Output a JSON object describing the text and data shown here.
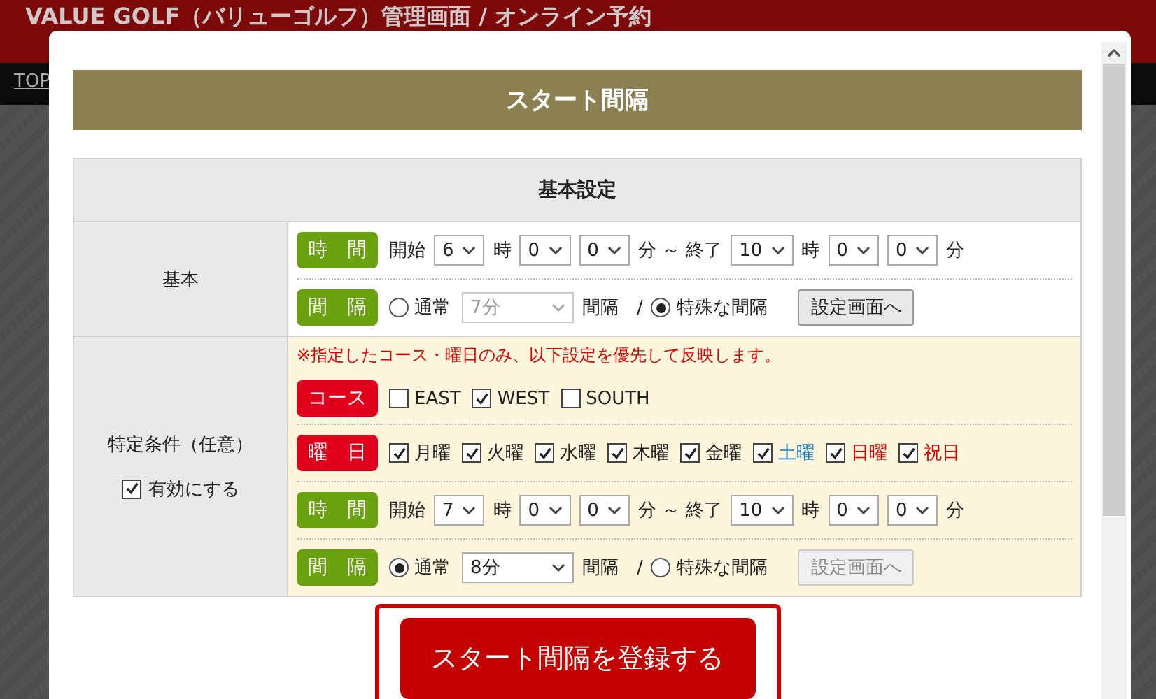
{
  "header": {
    "title": "VALUE GOLF（バリューゴルフ）管理画面 / オンライン予約"
  },
  "nav": {
    "link": "TOP"
  },
  "modal": {
    "title": "スタート間隔",
    "table_heading": "基本設定",
    "sections": [
      {
        "label": "基本",
        "rows": [
          {
            "kind": "controls",
            "tag": {
              "text": "時　間",
              "color": "#6aa10e"
            },
            "parts": [
              {
                "kind": "text",
                "text": "開始"
              },
              {
                "kind": "select",
                "value": "6",
                "disabled": false
              },
              {
                "kind": "text",
                "text": "時"
              },
              {
                "kind": "select",
                "value": "0",
                "disabled": false
              },
              {
                "kind": "select",
                "value": "0",
                "disabled": false
              },
              {
                "kind": "text",
                "text": "分 ～ 終了"
              },
              {
                "kind": "select",
                "value": "10",
                "disabled": false
              },
              {
                "kind": "text",
                "text": "時"
              },
              {
                "kind": "select",
                "value": "0",
                "disabled": false
              },
              {
                "kind": "select",
                "value": "0",
                "disabled": false
              },
              {
                "kind": "text",
                "text": "分"
              }
            ]
          },
          {
            "kind": "controls",
            "tag": {
              "text": "間　隔",
              "color": "#6aa10e"
            },
            "parts": [
              {
                "kind": "radio",
                "text": "通常",
                "selected": false
              },
              {
                "kind": "wide-select",
                "value": "7分",
                "disabled": true
              },
              {
                "kind": "text",
                "text": "間隔　/"
              },
              {
                "kind": "radio",
                "text": "特殊な間隔",
                "selected": true
              },
              {
                "kind": "button",
                "text": "設定画面へ",
                "disabled": false
              }
            ]
          }
        ]
      },
      {
        "label": "特定条件（任意）",
        "checkbox": {
          "text": "有効にする",
          "checked": true
        },
        "rows": [
          {
            "kind": "note",
            "text": "※指定したコース・曜日のみ、以下設定を優先して反映します。"
          },
          {
            "kind": "controls",
            "tag": {
              "text": "コース",
              "color": "#e0001b"
            },
            "parts": [
              {
                "kind": "checkbox",
                "text": "EAST",
                "checked": false
              },
              {
                "kind": "checkbox",
                "text": "WEST",
                "checked": true
              },
              {
                "kind": "checkbox",
                "text": "SOUTH",
                "checked": false
              }
            ]
          },
          {
            "kind": "controls",
            "tag": {
              "text": "曜　日",
              "color": "#e0001b"
            },
            "parts": [
              {
                "kind": "checkbox",
                "text": "月曜",
                "checked": true,
                "color": "#222222"
              },
              {
                "kind": "checkbox",
                "text": "火曜",
                "checked": true,
                "color": "#222222"
              },
              {
                "kind": "checkbox",
                "text": "水曜",
                "checked": true,
                "color": "#222222"
              },
              {
                "kind": "checkbox",
                "text": "木曜",
                "checked": true,
                "color": "#222222"
              },
              {
                "kind": "checkbox",
                "text": "金曜",
                "checked": true,
                "color": "#222222"
              },
              {
                "kind": "checkbox",
                "text": "土曜",
                "checked": true,
                "color": "#1a7fd0"
              },
              {
                "kind": "checkbox",
                "text": "日曜",
                "checked": true,
                "color": "#e00000"
              },
              {
                "kind": "checkbox",
                "text": "祝日",
                "checked": true,
                "color": "#e00000"
              }
            ]
          },
          {
            "kind": "controls",
            "tag": {
              "text": "時　間",
              "color": "#6aa10e"
            },
            "parts": [
              {
                "kind": "text",
                "text": "開始"
              },
              {
                "kind": "select",
                "value": "7",
                "disabled": false
              },
              {
                "kind": "text",
                "text": "時"
              },
              {
                "kind": "select",
                "value": "0",
                "disabled": false
              },
              {
                "kind": "select",
                "value": "0",
                "disabled": false
              },
              {
                "kind": "text",
                "text": "分 ～ 終了"
              },
              {
                "kind": "select",
                "value": "10",
                "disabled": false
              },
              {
                "kind": "text",
                "text": "時"
              },
              {
                "kind": "select",
                "value": "0",
                "disabled": false
              },
              {
                "kind": "select",
                "value": "0",
                "disabled": false
              },
              {
                "kind": "text",
                "text": "分"
              }
            ]
          },
          {
            "kind": "controls",
            "tag": {
              "text": "間　隔",
              "color": "#6aa10e"
            },
            "parts": [
              {
                "kind": "radio",
                "text": "通常",
                "selected": true
              },
              {
                "kind": "wide-select",
                "value": "8分",
                "disabled": false
              },
              {
                "kind": "text",
                "text": "間隔　/"
              },
              {
                "kind": "radio",
                "text": "特殊な間隔",
                "selected": false
              },
              {
                "kind": "button",
                "text": "設定画面へ",
                "disabled": true
              }
            ]
          }
        ]
      }
    ],
    "submit": "スタート間隔を登録する"
  }
}
